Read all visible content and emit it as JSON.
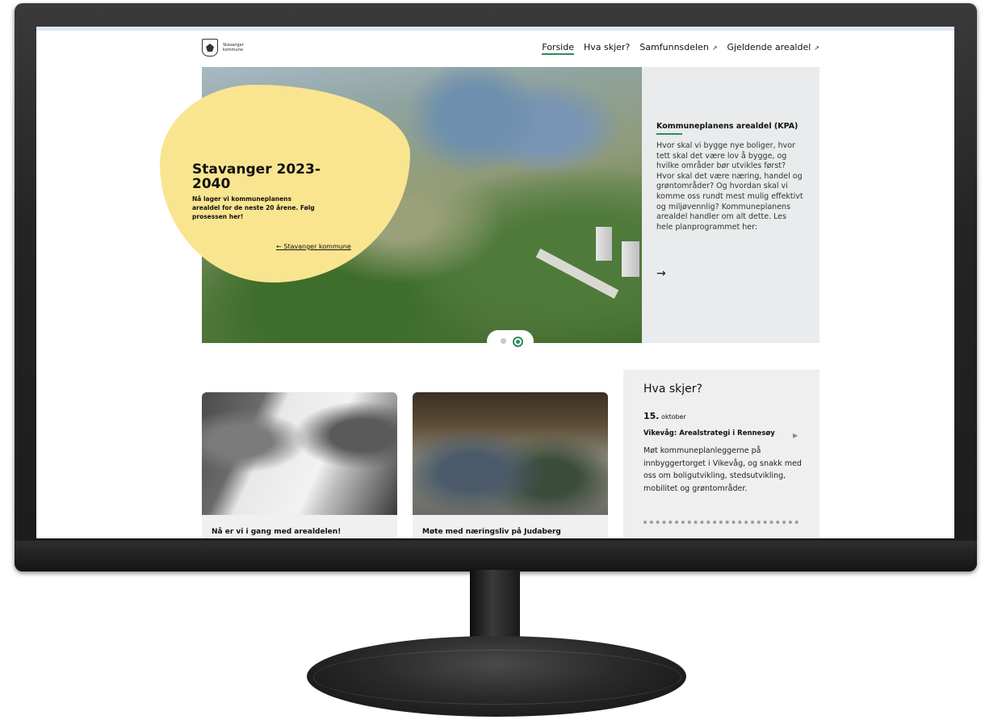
{
  "site": {
    "logo_line1": "Stavanger",
    "logo_line2": "kommune"
  },
  "nav": {
    "items": [
      {
        "label": "Forside",
        "external": false
      },
      {
        "label": "Hva skjer?",
        "external": false
      },
      {
        "label": "Samfunnsdelen",
        "external": true
      },
      {
        "label": "Gjeldende arealdel",
        "external": true
      }
    ],
    "external_arrow": "↗"
  },
  "hero": {
    "title": "Stavanger 2023-2040",
    "text": "Nå lager vi kommuneplanens arealdel for de neste 20 årene. Følg prosessen her!",
    "back_link": "← Stavanger kommune",
    "panel_title": "Kommuneplanens arealdel (KPA)",
    "panel_text": "Hvor skal vi bygge nye boliger, hvor tett skal det være lov å bygge, og hvilke områder bør utvikles først? Hvor skal det være næring, handel og grøntområder? Og hvordan skal vi komme oss rundt mest mulig effektivt og miljøvennlig? Kommuneplanens arealdel handler om alt dette. Les hele planprogrammet her:",
    "panel_arrow": "→",
    "active_slide": 2,
    "slides": 2
  },
  "cards": [
    {
      "label": "Nå er vi i gang med arealdelen!"
    },
    {
      "label": "Møte med næringsliv på Judaberg"
    }
  ],
  "events": {
    "title": "Hva skjer?",
    "date_day": "15.",
    "date_month": "oktober",
    "name": "Vikevåg: Arealstrategi i Rennesøy",
    "play_icon": "▶",
    "text": "Møt kommuneplanleggerne på innbyggertorget i Vikevåg, og snakk med oss om boligutvikling, stedsutvikling, mobilitet og grøntområder."
  },
  "colors": {
    "accent": "#2d8c5a",
    "blob": "#f9e58f",
    "panel_bg": "#e9ebec"
  }
}
